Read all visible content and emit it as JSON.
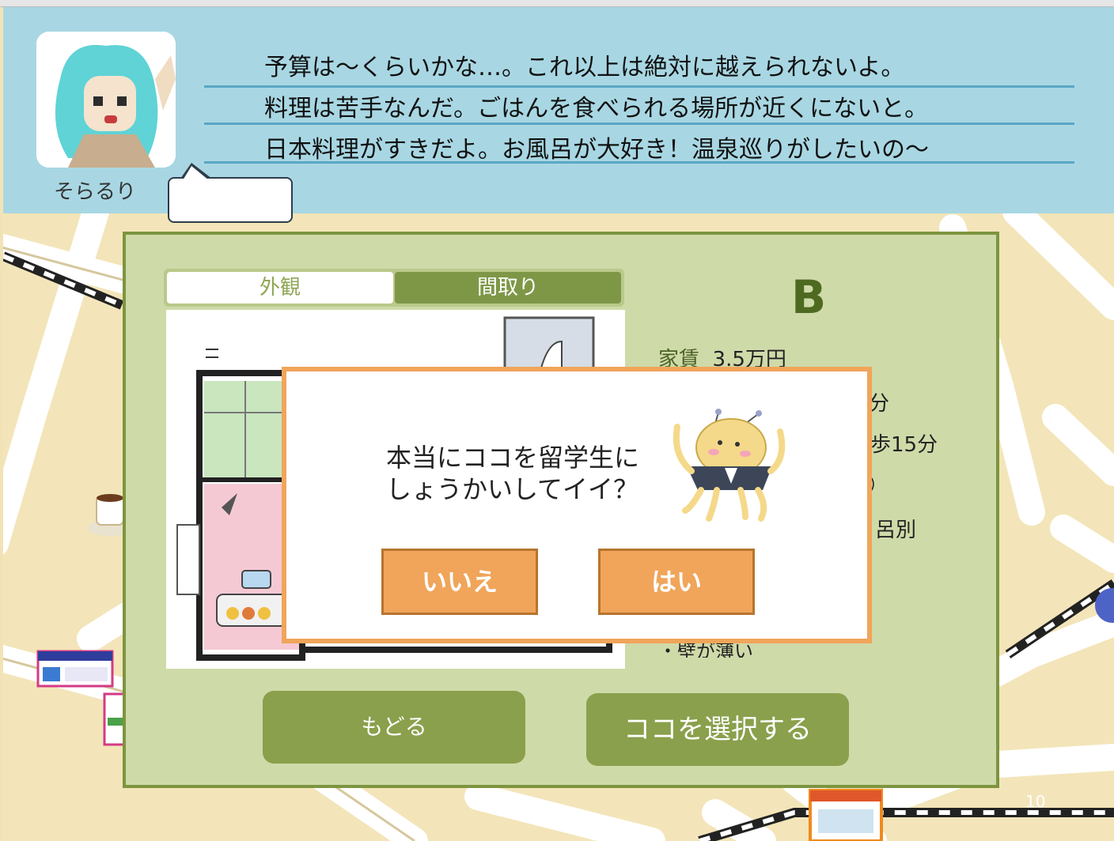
{
  "header": {
    "character_name": "そらるり",
    "lines": [
      "予算は～くらいかな…。これ以上は絶対に越えられないよ。",
      "料理は苦手なんだ。ごはんを食べられる場所が近くにないと。",
      "日本料理がすきだよ。お風呂が大好き！温泉巡りがしたいの～"
    ]
  },
  "tabs": {
    "exterior": "外観",
    "floorplan": "間取り"
  },
  "property": {
    "letter": "B",
    "rent_label": "家賃",
    "rent_value": "3.5万円",
    "partial_1": "分",
    "partial_2": "歩15分",
    "partial_3": "）",
    "partial_4": "呂別",
    "partial_5": "・壁が薄い"
  },
  "buttons": {
    "back": "もどる",
    "select": "ココを選択する"
  },
  "dialog": {
    "line1": "本当にココを留学生に",
    "line2": "しょうかいしてイイ？",
    "no": "いいえ",
    "yes": "はい"
  },
  "page_number": "10",
  "colors": {
    "header_bg": "#a8d7e3",
    "panel_bg": "#cfdaa9",
    "panel_border": "#7d953f",
    "button_green": "#8aa04c",
    "dialog_orange": "#f0a55a"
  }
}
